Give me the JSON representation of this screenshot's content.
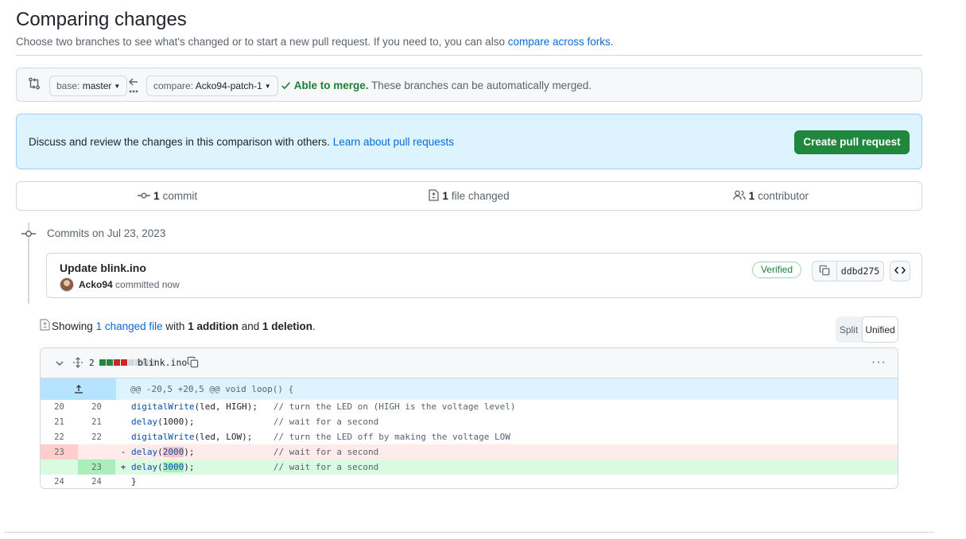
{
  "page": {
    "title": "Comparing changes",
    "subtitle": "Choose two branches to see what's changed or to start a new pull request. If you need to, you can also",
    "subtitle_link": "compare across forks."
  },
  "range": {
    "base_key": "base:",
    "base_value": "master",
    "compare_key": "compare:",
    "compare_value": "Acko94-patch-1",
    "merge_ok": "Able to merge.",
    "merge_detail": "These branches can be automatically merged."
  },
  "flash": {
    "text": "Discuss and review the changes in this comparison with others.",
    "link": "Learn about pull requests",
    "button": "Create pull request"
  },
  "numbers": {
    "commits_count": "1",
    "commits_label": "commit",
    "files_count": "1",
    "files_label": "file changed",
    "contributors_count": "1",
    "contributors_label": "contributor"
  },
  "commits": {
    "date_heading": "Commits on Jul 23, 2023",
    "items": [
      {
        "message": "Update blink.ino",
        "author": "Acko94",
        "when": "committed now",
        "badge": "Verified",
        "sha": "ddbd275"
      }
    ]
  },
  "summary": {
    "prefix": "Showing",
    "files_link": "1 changed file",
    "with": "with",
    "additions": "1 addition",
    "and": "and",
    "deletions": "1 deletion",
    "end": "."
  },
  "view_toggle": {
    "split": "Split",
    "unified": "Unified",
    "selected": "Unified"
  },
  "file": {
    "changes": "2",
    "name": "blink.ino",
    "more": "···",
    "diffstat_colors": [
      "#1f883d",
      "#1f883d",
      "#cf222e",
      "#cf222e",
      "#d1d9e0",
      "#d1d9e0",
      "#d1d9e0",
      "#d1d9e0"
    ],
    "hunk_header": "@@ -20,5 +20,5 @@ void loop() {",
    "lines": [
      {
        "type": "ctx",
        "old": "20",
        "new": "20",
        "marker": "",
        "fn": "digitalWrite",
        "args": "(led, HIGH);",
        "pad": "   ",
        "comment": "// turn the LED on (HIGH is the voltage level)"
      },
      {
        "type": "ctx",
        "old": "21",
        "new": "21",
        "marker": "",
        "fn": "delay",
        "args": "(1000);",
        "pad": "               ",
        "comment": "// wait for a second"
      },
      {
        "type": "ctx",
        "old": "22",
        "new": "22",
        "marker": "",
        "fn": "digitalWrite",
        "args": "(led, LOW);",
        "pad": "    ",
        "comment": "// turn the LED off by making the voltage LOW"
      },
      {
        "type": "del",
        "old": "23",
        "new": "",
        "marker": "-",
        "fn": "delay",
        "args_pre": "(",
        "hl": "2000",
        "args_post": ");",
        "pad": "               ",
        "comment": "// wait for a second"
      },
      {
        "type": "add",
        "old": "",
        "new": "23",
        "marker": "+",
        "fn": "delay",
        "args_pre": "(",
        "hl": "3000",
        "args_post": ");",
        "pad": "               ",
        "comment": "// wait for a second"
      },
      {
        "type": "ctx",
        "old": "24",
        "new": "24",
        "marker": "",
        "text": "}"
      }
    ]
  },
  "colors": {
    "accent": "#0969da",
    "success": "#1f883d",
    "danger": "#cf222e"
  }
}
